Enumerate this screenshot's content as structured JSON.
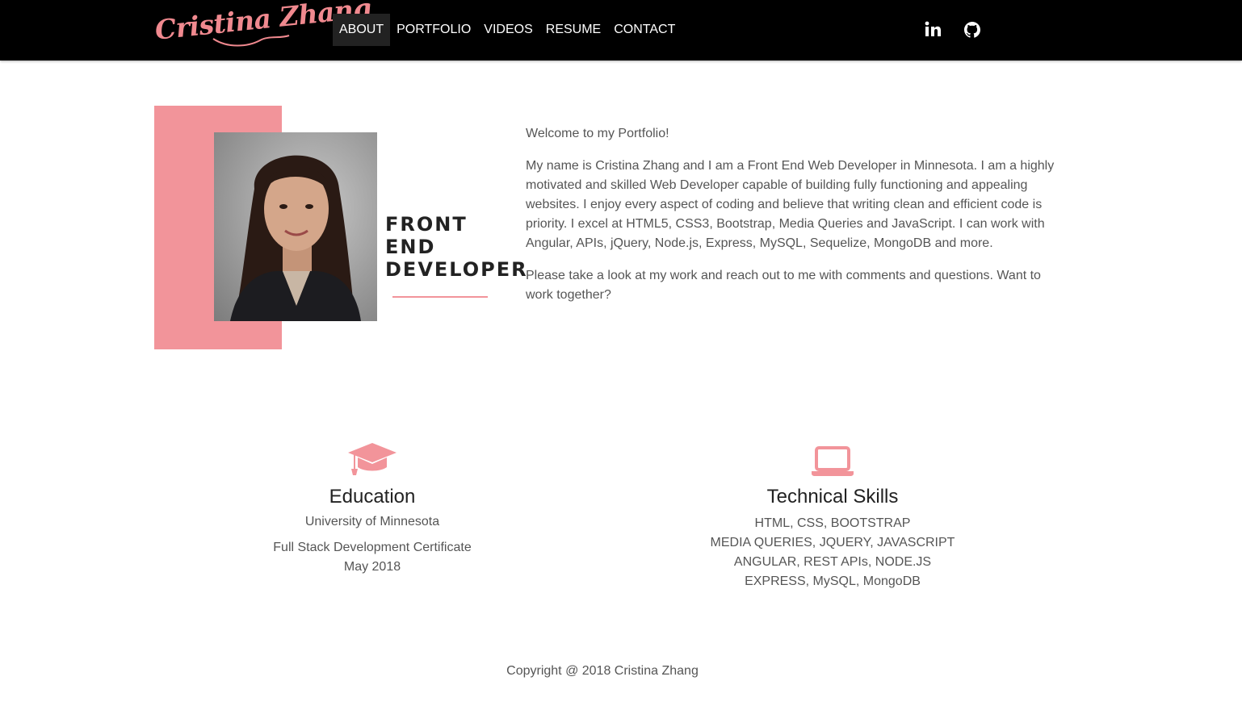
{
  "navbar": {
    "brand": "Cristina Zhang",
    "items": [
      {
        "label": "ABOUT",
        "active": true
      },
      {
        "label": "PORTFOLIO",
        "active": false
      },
      {
        "label": "VIDEOS",
        "active": false
      },
      {
        "label": "RESUME",
        "active": false
      },
      {
        "label": "CONTACT",
        "active": false
      }
    ],
    "social": [
      {
        "icon": "linkedin-icon"
      },
      {
        "icon": "github-icon"
      }
    ]
  },
  "about": {
    "headline": [
      "FRONT",
      "END",
      "DEVELOPER"
    ],
    "paragraphs": [
      "Welcome to my Portfolio!",
      "My name is Cristina Zhang and I am a Front End Web Developer in Minnesota. I am a highly motivated and skilled Web Developer capable of building fully functioning and appealing websites. I enjoy every aspect of coding and believe that writing clean and efficient code is priority. I excel at HTML5, CSS3, Bootstrap, Media Queries and JavaScript. I can work with Angular, APIs, jQuery, Node.js, Express, MySQL, Sequelize, MongoDB and more.",
      "Please take a look at my work and reach out to me with comments and questions. Want to work together?"
    ]
  },
  "education": {
    "icon": "graduation-cap-icon",
    "title": "Education",
    "school": "University of Minnesota",
    "certificate": "Full Stack Development Certificate",
    "date": "May 2018"
  },
  "skills": {
    "icon": "laptop-icon",
    "title": "Technical Skills",
    "lines": [
      "HTML, CSS, BOOTSTRAP",
      "MEDIA QUERIES, JQUERY, JAVASCRIPT",
      "ANGULAR, REST APIs, NODE.JS",
      "EXPRESS, MySQL, MongoDB"
    ]
  },
  "footer": {
    "copyright": "Copyright @ 2018 Cristina Zhang"
  },
  "colors": {
    "accent": "#f2949a",
    "navbar": "#000000",
    "nav_active": "#222222",
    "text": "#555555"
  }
}
